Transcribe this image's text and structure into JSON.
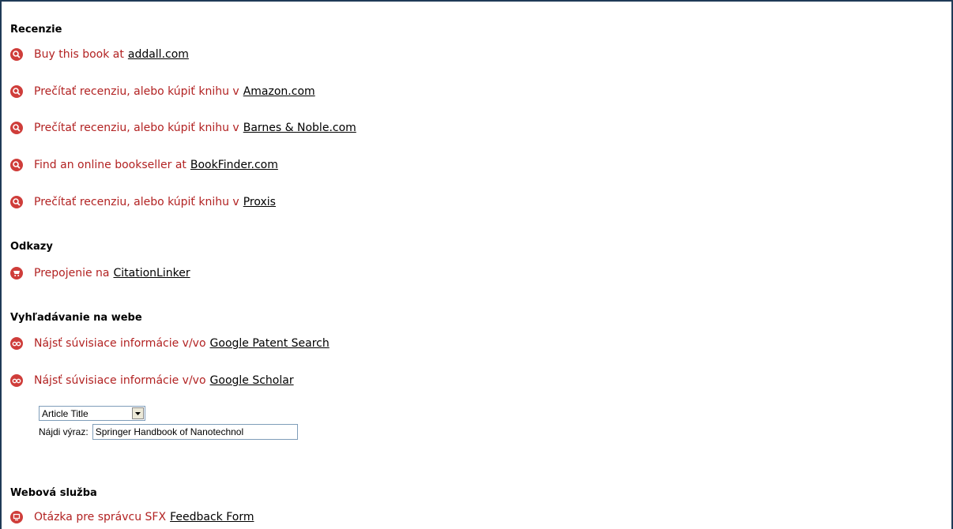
{
  "colors": {
    "frame_border": "#1f3b57",
    "icon_red": "#cf3d3a",
    "text_red": "#b22222",
    "link": "#000000"
  },
  "sections": {
    "reviews": {
      "title": "Recenzie",
      "items": [
        {
          "icon": "search-magnifier-icon",
          "text": "Buy this book at",
          "link": "addall.com"
        },
        {
          "icon": "search-magnifier-icon",
          "text": "Prečítať recenziu, alebo kúpiť knihu v",
          "link": "Amazon.com"
        },
        {
          "icon": "search-magnifier-icon",
          "text": "Prečítať recenziu, alebo kúpiť knihu v",
          "link": "Barnes & Noble.com"
        },
        {
          "icon": "search-magnifier-icon",
          "text": "Find an online bookseller at",
          "link": "BookFinder.com"
        },
        {
          "icon": "search-magnifier-icon",
          "text": "Prečítať recenziu, alebo kúpiť knihu v",
          "link": "Proxis"
        }
      ]
    },
    "links": {
      "title": "Odkazy",
      "items": [
        {
          "icon": "cart-icon",
          "text": "Prepojenie na",
          "link": "CitationLinker"
        }
      ]
    },
    "web_search": {
      "title": "Vyhľadávanie na webe",
      "items": [
        {
          "icon": "binoculars-icon",
          "text": "Nájsť súvisiace informácie v/vo",
          "link": "Google Patent Search"
        },
        {
          "icon": "binoculars-icon",
          "text": "Nájsť súvisiace informácie v/vo",
          "link": "Google Scholar"
        }
      ],
      "search_form": {
        "select_value": "Article Title",
        "label": "Nájdi výraz:",
        "input_value": "Springer Handbook of Nanotechnol"
      }
    },
    "web_service": {
      "title": "Webová služba",
      "items": [
        {
          "icon": "monitor-icon",
          "text": "Otázka pre správcu SFX",
          "link": "Feedback Form"
        }
      ]
    }
  }
}
